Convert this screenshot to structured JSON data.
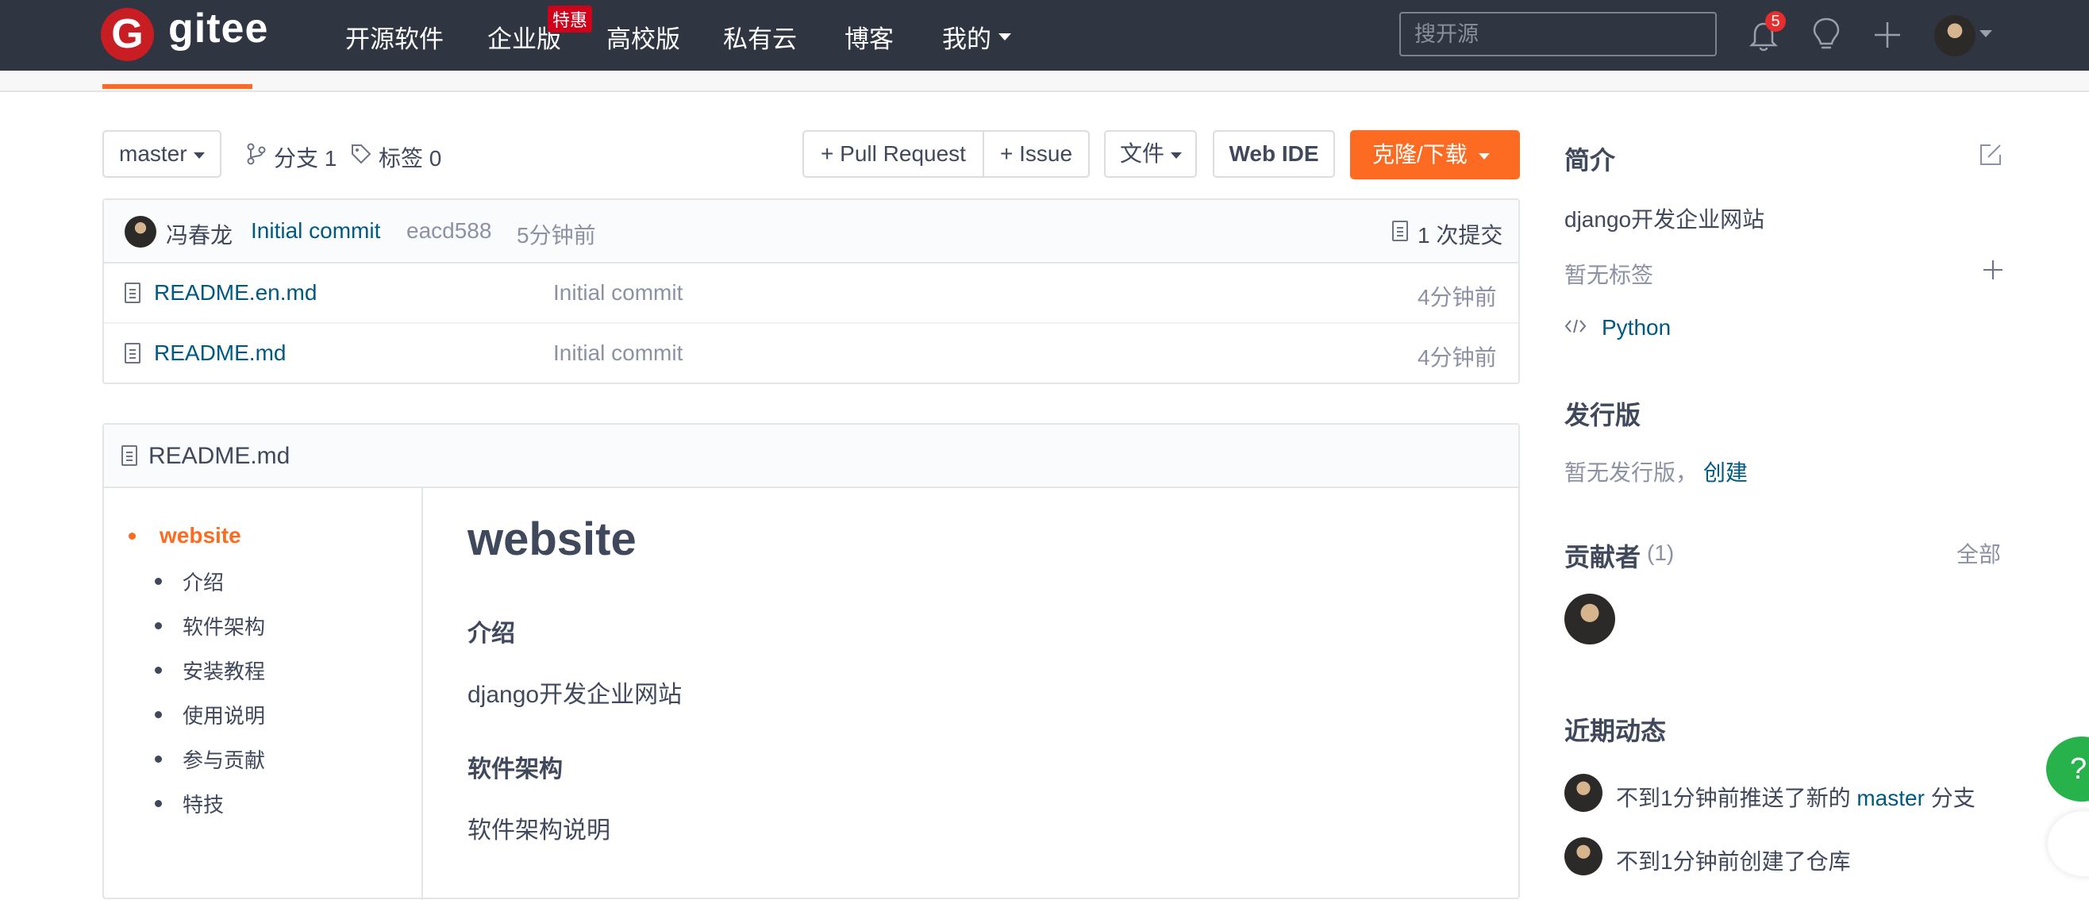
{
  "nav": {
    "logo_text": "gitee",
    "logo_letter": "G",
    "items": [
      "开源软件",
      "企业版",
      "高校版",
      "私有云",
      "博客",
      "我的"
    ],
    "badge": "特惠",
    "search_placeholder": "搜开源",
    "notifications": "5"
  },
  "repo": {
    "branch": "master",
    "branches_label": "分支 1",
    "tags_label": "标签 0",
    "pull_request": "+ Pull Request",
    "issue": "+ Issue",
    "file_menu": "文件",
    "web_ide": "Web IDE",
    "clone": "克隆/下载"
  },
  "commit": {
    "author": "冯春龙",
    "message": "Initial commit",
    "hash": "eacd588",
    "time": "5分钟前",
    "count": "1 次提交"
  },
  "files": [
    {
      "name": "README.en.md",
      "message": "Initial commit",
      "time": "4分钟前"
    },
    {
      "name": "README.md",
      "message": "Initial commit",
      "time": "4分钟前"
    }
  ],
  "readme": {
    "filename": "README.md",
    "toc": [
      "website",
      "介绍",
      "软件架构",
      "安装教程",
      "使用说明",
      "参与贡献",
      "特技"
    ],
    "h1": "website",
    "sections": [
      {
        "heading": "介绍",
        "text": "django开发企业网站"
      },
      {
        "heading": "软件架构",
        "text": "软件架构说明"
      }
    ]
  },
  "sidebar": {
    "intro_title": "简介",
    "description": "django开发企业网站",
    "no_tags": "暂无标签",
    "language": "Python",
    "releases_title": "发行版",
    "no_releases": "暂无发行版，",
    "create": "创建",
    "contributors_title": "贡献者",
    "contributors_count": "(1)",
    "all": "全部",
    "activity_title": "近期动态",
    "activity": [
      {
        "pre": "不到1分钟前推送了新的",
        "branch": "master",
        "post": "分支"
      },
      {
        "text": "不到1分钟前创建了仓库"
      }
    ]
  },
  "colors": {
    "brand_red": "#c71d23",
    "accent_orange": "#fc6b21",
    "link_blue": "#005980",
    "nav_bg": "#2f3541"
  },
  "icons": [
    "bell-icon",
    "lightbulb-icon",
    "plus-icon",
    "branch-icon",
    "tag-icon",
    "file-icon",
    "code-icon",
    "edit-icon",
    "help-icon"
  ]
}
